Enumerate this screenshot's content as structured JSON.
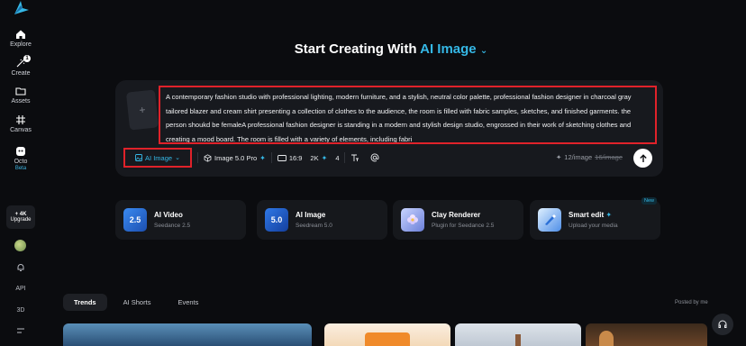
{
  "sidebar": {
    "items": [
      {
        "label": "Explore",
        "icon": "home-icon"
      },
      {
        "label": "Create",
        "icon": "create-wand-icon",
        "badge": "1"
      },
      {
        "label": "Assets",
        "icon": "folder-icon"
      },
      {
        "label": "Canvas",
        "icon": "canvas-hash-icon"
      },
      {
        "label": "Octo",
        "icon": "octo-icon",
        "tag": "Beta"
      }
    ],
    "upgrade": {
      "tier": "+ 4K",
      "label": "Upgrade"
    },
    "api_label": "API",
    "threed_label": "3D"
  },
  "header": {
    "prefix": "Start Creating With ",
    "accent": "AI Image",
    "chevron": "⌄"
  },
  "prompt": {
    "text": "A contemporary fashion studio with professional lighting, modern furniture, and a stylish, neutral color palette, professional fashion designer in charcoal gray tailored blazer and cream shirt presenting a collection of clothes to the audience, the room is filled with fabric samples, sketches, and finished garments. the person shoukd be femaleA professional fashion designer is standing in a modern and stylish design studio, engrossed in their work of sketching clothes and creating a mood board. The room is filled with a variety of elements, including fabri",
    "add_symbol": "+"
  },
  "toolbar": {
    "mode": "AI Image",
    "model": "Image 5.0 Pro",
    "ratio": "16:9",
    "resolution": "2K",
    "count": "4",
    "credits_new": "12/image",
    "credits_old": "16/image"
  },
  "features": [
    {
      "title": "AI Video",
      "subtitle": "Seedance 2.5",
      "icon_text": "2.5",
      "color": "#2a6fd6"
    },
    {
      "title": "AI Image",
      "subtitle": "Seedream 5.0",
      "icon_text": "5.0",
      "color": "#1f63c9"
    },
    {
      "title": "Clay Renderer",
      "subtitle": "Plugin for Seedance 2.5",
      "icon_text": "",
      "color": "#6b7fd8"
    },
    {
      "title": "Smart edit",
      "subtitle": "Upload your media",
      "icon_text": "",
      "color": "#3d7be0",
      "badge": "New"
    }
  ],
  "tabs": [
    "Trends",
    "AI Shorts",
    "Events"
  ],
  "posted_by": "Posted by me",
  "colors": {
    "accent": "#35b8e6",
    "highlight_border": "#e0222a",
    "card_bg": "#17191e",
    "page_bg": "#0b0c0f"
  }
}
